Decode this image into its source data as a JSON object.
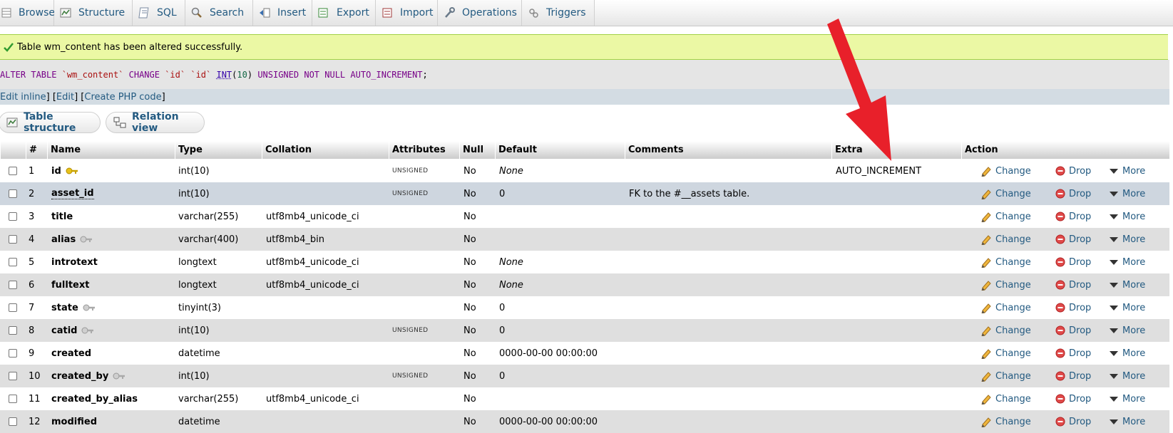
{
  "tabs": [
    {
      "label": "Browse",
      "icon": "browse-icon"
    },
    {
      "label": "Structure",
      "icon": "structure-icon"
    },
    {
      "label": "SQL",
      "icon": "sql-icon"
    },
    {
      "label": "Search",
      "icon": "search-icon"
    },
    {
      "label": "Insert",
      "icon": "insert-icon"
    },
    {
      "label": "Export",
      "icon": "export-icon"
    },
    {
      "label": "Import",
      "icon": "import-icon"
    },
    {
      "label": "Operations",
      "icon": "wrench-icon"
    },
    {
      "label": "Triggers",
      "icon": "triggers-icon"
    }
  ],
  "message": {
    "text": "Table wm_content has been altered successfully."
  },
  "sql": {
    "parts": [
      {
        "t": "ALTER TABLE ",
        "c": "kw"
      },
      {
        "t": "`wm_content`",
        "c": "str"
      },
      {
        "t": " CHANGE ",
        "c": "kw"
      },
      {
        "t": "`id`",
        "c": "str"
      },
      {
        "t": " ",
        "c": "plain"
      },
      {
        "t": "`id`",
        "c": "str"
      },
      {
        "t": " ",
        "c": "plain"
      },
      {
        "t": "INT",
        "c": "tp"
      },
      {
        "t": "(",
        "c": "plain"
      },
      {
        "t": "10",
        "c": "num"
      },
      {
        "t": ") ",
        "c": "plain"
      },
      {
        "t": "UNSIGNED",
        "c": "kw"
      },
      {
        "t": " ",
        "c": "plain"
      },
      {
        "t": "NOT",
        "c": "kw"
      },
      {
        "t": " NULL ",
        "c": "kw"
      },
      {
        "t": "AUTO_INCREMENT",
        "c": "kw"
      },
      {
        "t": ";",
        "c": "plain"
      }
    ]
  },
  "sql_links": {
    "edit_inline": "Edit inline",
    "edit": "Edit",
    "create_php": "Create PHP code",
    "sep_close": " ] [ ",
    "end": " ]"
  },
  "subtabs": {
    "structure": "Table structure",
    "relation": "Relation view"
  },
  "columns": {
    "num": "#",
    "name": "Name",
    "type": "Type",
    "collation": "Collation",
    "attributes": "Attributes",
    "null": "Null",
    "default": "Default",
    "comments": "Comments",
    "extra": "Extra",
    "action": "Action"
  },
  "actions": {
    "change": "Change",
    "drop": "Drop",
    "more": "More"
  },
  "rows": [
    {
      "num": "1",
      "name": "id",
      "key": "primary",
      "type": "int(10)",
      "collation": "",
      "attributes": "UNSIGNED",
      "null": "No",
      "default": "None",
      "default_italic": true,
      "comments": "",
      "extra": "AUTO_INCREMENT"
    },
    {
      "num": "2",
      "name": "asset_id",
      "key": "",
      "type": "int(10)",
      "collation": "",
      "attributes": "UNSIGNED",
      "null": "No",
      "default": "0",
      "default_italic": false,
      "comments": "FK to the #__assets table.",
      "extra": "",
      "dotted": true
    },
    {
      "num": "3",
      "name": "title",
      "key": "",
      "type": "varchar(255)",
      "collation": "utf8mb4_unicode_ci",
      "attributes": "",
      "null": "No",
      "default": "",
      "default_italic": false,
      "comments": "",
      "extra": ""
    },
    {
      "num": "4",
      "name": "alias",
      "key": "index",
      "type": "varchar(400)",
      "collation": "utf8mb4_bin",
      "attributes": "",
      "null": "No",
      "default": "",
      "default_italic": false,
      "comments": "",
      "extra": ""
    },
    {
      "num": "5",
      "name": "introtext",
      "key": "",
      "type": "longtext",
      "collation": "utf8mb4_unicode_ci",
      "attributes": "",
      "null": "No",
      "default": "None",
      "default_italic": true,
      "comments": "",
      "extra": ""
    },
    {
      "num": "6",
      "name": "fulltext",
      "key": "",
      "type": "longtext",
      "collation": "utf8mb4_unicode_ci",
      "attributes": "",
      "null": "No",
      "default": "None",
      "default_italic": true,
      "comments": "",
      "extra": ""
    },
    {
      "num": "7",
      "name": "state",
      "key": "index",
      "type": "tinyint(3)",
      "collation": "",
      "attributes": "",
      "null": "No",
      "default": "0",
      "default_italic": false,
      "comments": "",
      "extra": ""
    },
    {
      "num": "8",
      "name": "catid",
      "key": "index",
      "type": "int(10)",
      "collation": "",
      "attributes": "UNSIGNED",
      "null": "No",
      "default": "0",
      "default_italic": false,
      "comments": "",
      "extra": ""
    },
    {
      "num": "9",
      "name": "created",
      "key": "",
      "type": "datetime",
      "collation": "",
      "attributes": "",
      "null": "No",
      "default": "0000-00-00 00:00:00",
      "default_italic": false,
      "comments": "",
      "extra": ""
    },
    {
      "num": "10",
      "name": "created_by",
      "key": "index",
      "type": "int(10)",
      "collation": "",
      "attributes": "UNSIGNED",
      "null": "No",
      "default": "0",
      "default_italic": false,
      "comments": "",
      "extra": ""
    },
    {
      "num": "11",
      "name": "created_by_alias",
      "key": "",
      "type": "varchar(255)",
      "collation": "utf8mb4_unicode_ci",
      "attributes": "",
      "null": "No",
      "default": "",
      "default_italic": false,
      "comments": "",
      "extra": ""
    },
    {
      "num": "12",
      "name": "modified",
      "key": "",
      "type": "datetime",
      "collation": "",
      "attributes": "",
      "null": "No",
      "default": "0000-00-00 00:00:00",
      "default_italic": false,
      "comments": "",
      "extra": ""
    }
  ],
  "colors": {
    "link": "#235a81",
    "success_bg": "#ebf8a4",
    "row_even": "#dfdfdf",
    "row_highlight": "#ced6df",
    "arrow": "#e8202a"
  }
}
